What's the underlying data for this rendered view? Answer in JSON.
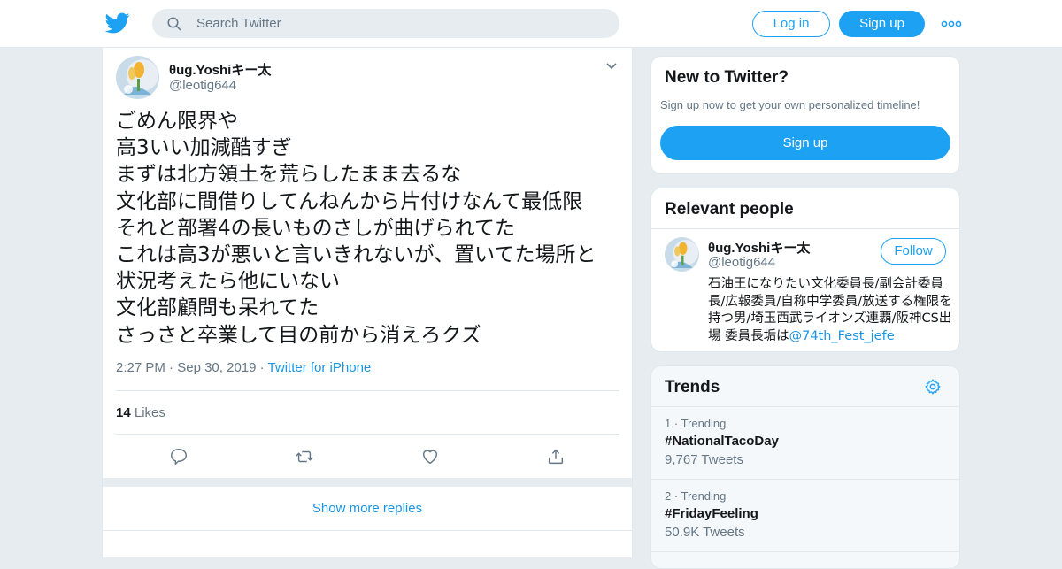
{
  "colors": {
    "brand": "#1da1f2",
    "link": "#1b95e0",
    "muted": "#657786",
    "text": "#14171a"
  },
  "header": {
    "search_placeholder": "Search Twitter",
    "login_label": "Log in",
    "signup_label": "Sign up"
  },
  "tweet": {
    "display_name": "θug.Yoshiキー太",
    "handle": "@leotig644",
    "lines": [
      "ごめん限界や",
      "高3いい加減酷すぎ",
      "まずは北方領土を荒らしたまま去るな",
      "文化部に間借りしてんねんから片付けなんて最低限",
      "それと部署4の長いものさしが曲げられてた",
      "これは高3が悪いと言いきれないが、置いてた場所と",
      "状況考えたら他にいない",
      "文化部顧問も呆れてた",
      "さっさと卒業して目の前から消えろクズ"
    ],
    "time": "2:27 PM",
    "date": "Sep 30, 2019",
    "source": "Twitter for iPhone",
    "likes_count": "14",
    "likes_label": "Likes"
  },
  "show_more_replies": "Show more replies",
  "new_to_twitter": {
    "title": "New to Twitter?",
    "subtitle": "Sign up now to get your own personalized timeline!",
    "button": "Sign up"
  },
  "relevant_people": {
    "title": "Relevant people",
    "person": {
      "name": "θug.Yoshiキー太",
      "handle": "@leotig644",
      "follow_label": "Follow",
      "bio": "石油王になりたい文化委員長/副会計委員長/広報委員/自称中学委員/放送する権限を持つ男/埼玉西武ライオンズ連覇/阪神CS出場 委員長垢は",
      "bio_link": "@74th_Fest_jefe"
    }
  },
  "trends": {
    "title": "Trends",
    "items": [
      {
        "rank": "1",
        "context": "Trending",
        "name": "#NationalTacoDay",
        "count": "9,767 Tweets"
      },
      {
        "rank": "2",
        "context": "Trending",
        "name": "#FridayFeeling",
        "count": "50.9K Tweets"
      }
    ]
  }
}
